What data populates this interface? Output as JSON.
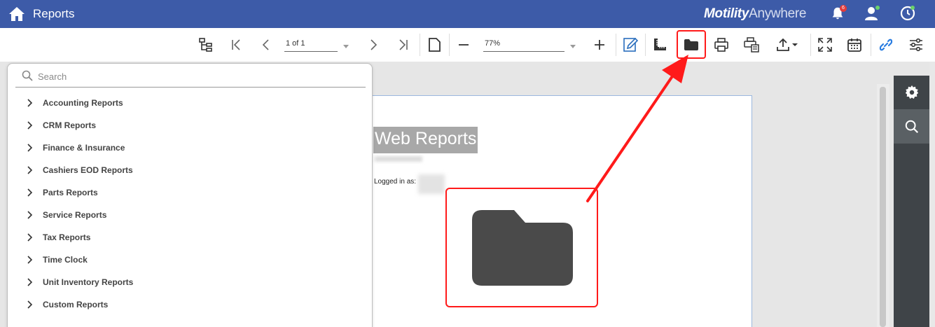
{
  "header": {
    "title": "Reports",
    "brand_bold": "Motility",
    "brand_light": "Anywhere",
    "notification_count": "6"
  },
  "toolbar": {
    "page_value": "1 of 1",
    "zoom_value": "77%"
  },
  "search": {
    "placeholder": "Search"
  },
  "tree": {
    "items": [
      {
        "label": "Accounting Reports"
      },
      {
        "label": "CRM Reports"
      },
      {
        "label": "Finance & Insurance"
      },
      {
        "label": "Cashiers EOD Reports"
      },
      {
        "label": "Parts Reports"
      },
      {
        "label": "Service Reports"
      },
      {
        "label": "Tax Reports"
      },
      {
        "label": "Time Clock"
      },
      {
        "label": "Unit Inventory Reports"
      },
      {
        "label": "Custom Reports"
      }
    ]
  },
  "report": {
    "title": "Web Reports",
    "logged_in_label": "Logged in as:"
  },
  "colors": {
    "header_bg": "#3d5ba8",
    "highlight": "#ff1a1a",
    "link_icon": "#2a7de1"
  }
}
